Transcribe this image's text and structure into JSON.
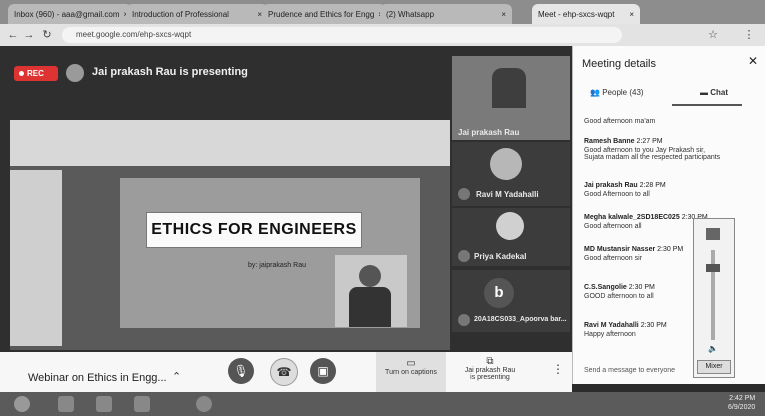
{
  "browser": {
    "tabs": [
      {
        "label": "Inbox (960) - aaa@gmail.com"
      },
      {
        "label": "Introduction of Professional"
      },
      {
        "label": "Prudence and Ethics for Engg"
      },
      {
        "label": "(2) Whatsapp"
      },
      {
        "label": "Meet - ehp-sxcs-wqpt"
      }
    ],
    "url": "meet.google.com/ehp-sxcs-wqpt"
  },
  "meeting": {
    "rec_label": "REC",
    "presenting_title": "Jai prakash Rau is presenting",
    "slide_title": "ETHICS FOR ENGINEERS",
    "slide_author": "by: jaiprakash Rau",
    "participants": [
      {
        "name": "Jai prakash Rau"
      },
      {
        "name": "Ravi M Yadahalli"
      },
      {
        "name": "Priya Kadekal"
      },
      {
        "name": "20A18CS033_Apoorva bar...",
        "initial": "b"
      }
    ],
    "name": "Webinar on Ethics in Engg...",
    "controls": {
      "captions_label": "Turn on captions",
      "presenting_label_1": "Jai prakash Rau",
      "presenting_label_2": "is presenting",
      "more": "⋮"
    }
  },
  "panel": {
    "title": "Meeting details",
    "tabs": {
      "people": "People (43)",
      "chat": "Chat"
    },
    "first_text": "Good afternoon ma'am",
    "messages": [
      {
        "name": "Ramesh Banne",
        "time": "2:27 PM",
        "text": "Good afternoon to you Jay Prakash sir, Sujata madam all the respected participants"
      },
      {
        "name": "Jai prakash Rau",
        "time": "2:28 PM",
        "text": "Good Afternoon to all"
      },
      {
        "name": "Megha kalwale_2SD18EC025",
        "time": "2:30 PM",
        "text": "Good afternoon all"
      },
      {
        "name": "MD Mustansir Nasser",
        "time": "2:30 PM",
        "text": "Good afternoon sir"
      },
      {
        "name": "C.S.Sangolie",
        "time": "2:30 PM",
        "text": "GOOD afternoon to all"
      },
      {
        "name": "Ravi M Yadahalli",
        "time": "2:30 PM",
        "text": "Happy afternoon"
      }
    ],
    "input_placeholder": "Send a message to everyone"
  },
  "volume": {
    "mixer_label": "Mixer",
    "level": 0.8
  },
  "taskbar": {
    "time": "2:42 PM",
    "date": "6/9/2020"
  }
}
